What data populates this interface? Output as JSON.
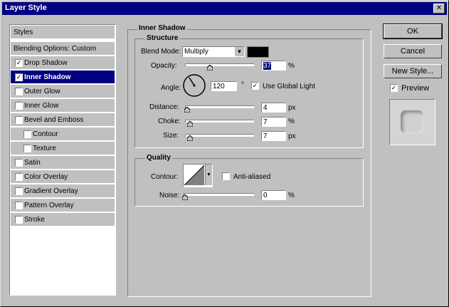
{
  "window": {
    "title": "Layer Style"
  },
  "styles_list": {
    "header": "Styles",
    "blending": "Blending Options: Custom",
    "items": [
      {
        "label": "Drop Shadow",
        "checked": true
      },
      {
        "label": "Inner Shadow",
        "checked": true,
        "selected": true
      },
      {
        "label": "Outer Glow",
        "checked": false
      },
      {
        "label": "Inner Glow",
        "checked": false
      },
      {
        "label": "Bevel and Emboss",
        "checked": false
      },
      {
        "label": "Contour",
        "checked": false
      },
      {
        "label": "Texture",
        "checked": false
      },
      {
        "label": "Satin",
        "checked": false
      },
      {
        "label": "Color Overlay",
        "checked": false
      },
      {
        "label": "Gradient Overlay",
        "checked": false
      },
      {
        "label": "Pattern Overlay",
        "checked": false
      },
      {
        "label": "Stroke",
        "checked": false
      }
    ]
  },
  "inner_shadow": {
    "section_title": "Inner Shadow",
    "structure": {
      "title": "Structure",
      "blend_mode_label": "Blend Mode:",
      "blend_mode_value": "Multiply",
      "shadow_color": "#000000",
      "opacity_label": "Opacity:",
      "opacity_value": "37",
      "opacity_unit": "%",
      "angle_label": "Angle:",
      "angle_value": "120",
      "angle_unit": "°",
      "global_light_label": "Use Global Light",
      "global_light_checked": true,
      "distance_label": "Distance:",
      "distance_value": "4",
      "distance_unit": "px",
      "choke_label": "Choke:",
      "choke_value": "7",
      "choke_unit": "%",
      "size_label": "Size:",
      "size_value": "7",
      "size_unit": "px"
    },
    "quality": {
      "title": "Quality",
      "contour_label": "Contour:",
      "antialiased_label": "Anti-aliased",
      "antialiased_checked": false,
      "noise_label": "Noise:",
      "noise_value": "0",
      "noise_unit": "%"
    }
  },
  "buttons": {
    "ok": "OK",
    "cancel": "Cancel",
    "new_style": "New Style...",
    "preview_label": "Preview",
    "preview_checked": true
  }
}
